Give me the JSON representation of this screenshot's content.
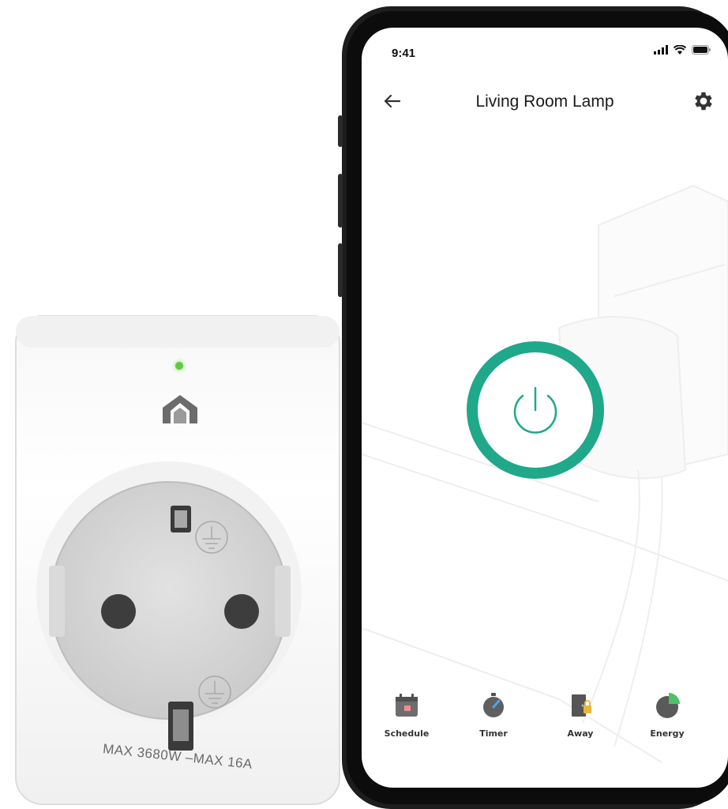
{
  "plug": {
    "rating_text": "MAX 3680W –MAX 16A",
    "led_color": "#5ecb3a"
  },
  "phone": {
    "status_bar": {
      "time": "9:41"
    },
    "header": {
      "title": "Living Room Lamp"
    },
    "power": {
      "ring_color": "#1fa88a"
    },
    "bottom_nav": [
      {
        "label": "Schedule",
        "icon": "schedule-icon"
      },
      {
        "label": "Timer",
        "icon": "timer-icon"
      },
      {
        "label": "Away",
        "icon": "away-icon"
      },
      {
        "label": "Energy",
        "icon": "energy-icon"
      }
    ]
  }
}
